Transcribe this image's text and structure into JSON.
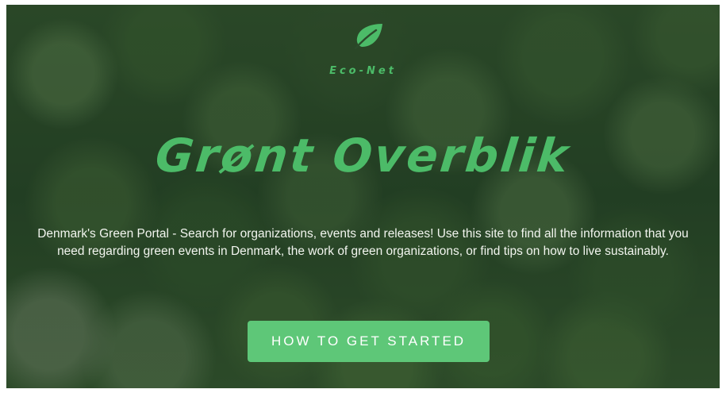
{
  "brand": {
    "name": "Eco-Net",
    "icon": "leaf-icon",
    "accent_color": "#4cbb68"
  },
  "hero": {
    "title": "Grønt Overblik",
    "description": "Denmark's Green Portal - Search for organizations, events and releases! Use this site to find all the information that you need regarding green events in Denmark, the work of green organizations, or find tips on how to live sustainably.",
    "cta_label": "How to get started",
    "cta_color": "#5ec778"
  }
}
